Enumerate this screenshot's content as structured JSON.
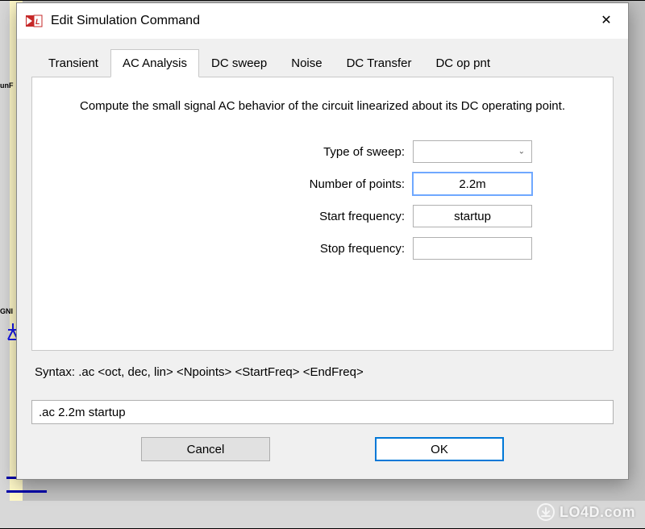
{
  "window": {
    "title": "Edit Simulation Command"
  },
  "tabs": [
    {
      "label": "Transient"
    },
    {
      "label": "AC Analysis"
    },
    {
      "label": "DC sweep"
    },
    {
      "label": "Noise"
    },
    {
      "label": "DC Transfer"
    },
    {
      "label": "DC op pnt"
    }
  ],
  "panel": {
    "description": "Compute the small signal AC behavior of the circuit linearized about its DC operating point.",
    "fields": {
      "type_of_sweep": {
        "label": "Type of sweep:",
        "value": ""
      },
      "number_of_points": {
        "label": "Number of points:",
        "value": "2.2m"
      },
      "start_frequency": {
        "label": "Start frequency:",
        "value": "startup"
      },
      "stop_frequency": {
        "label": "Stop frequency:",
        "value": ""
      }
    }
  },
  "syntax": {
    "prefix": "Syntax:   ",
    "text": ".ac <oct, dec, lin> <Npoints> <StartFreq> <EndFreq>"
  },
  "command": {
    "value": ".ac 2.2m startup"
  },
  "buttons": {
    "cancel": "Cancel",
    "ok": "OK"
  },
  "watermark": {
    "text": "LO4D.com"
  },
  "bg": {
    "label_top": "unF",
    "label_mid": "GNI"
  }
}
